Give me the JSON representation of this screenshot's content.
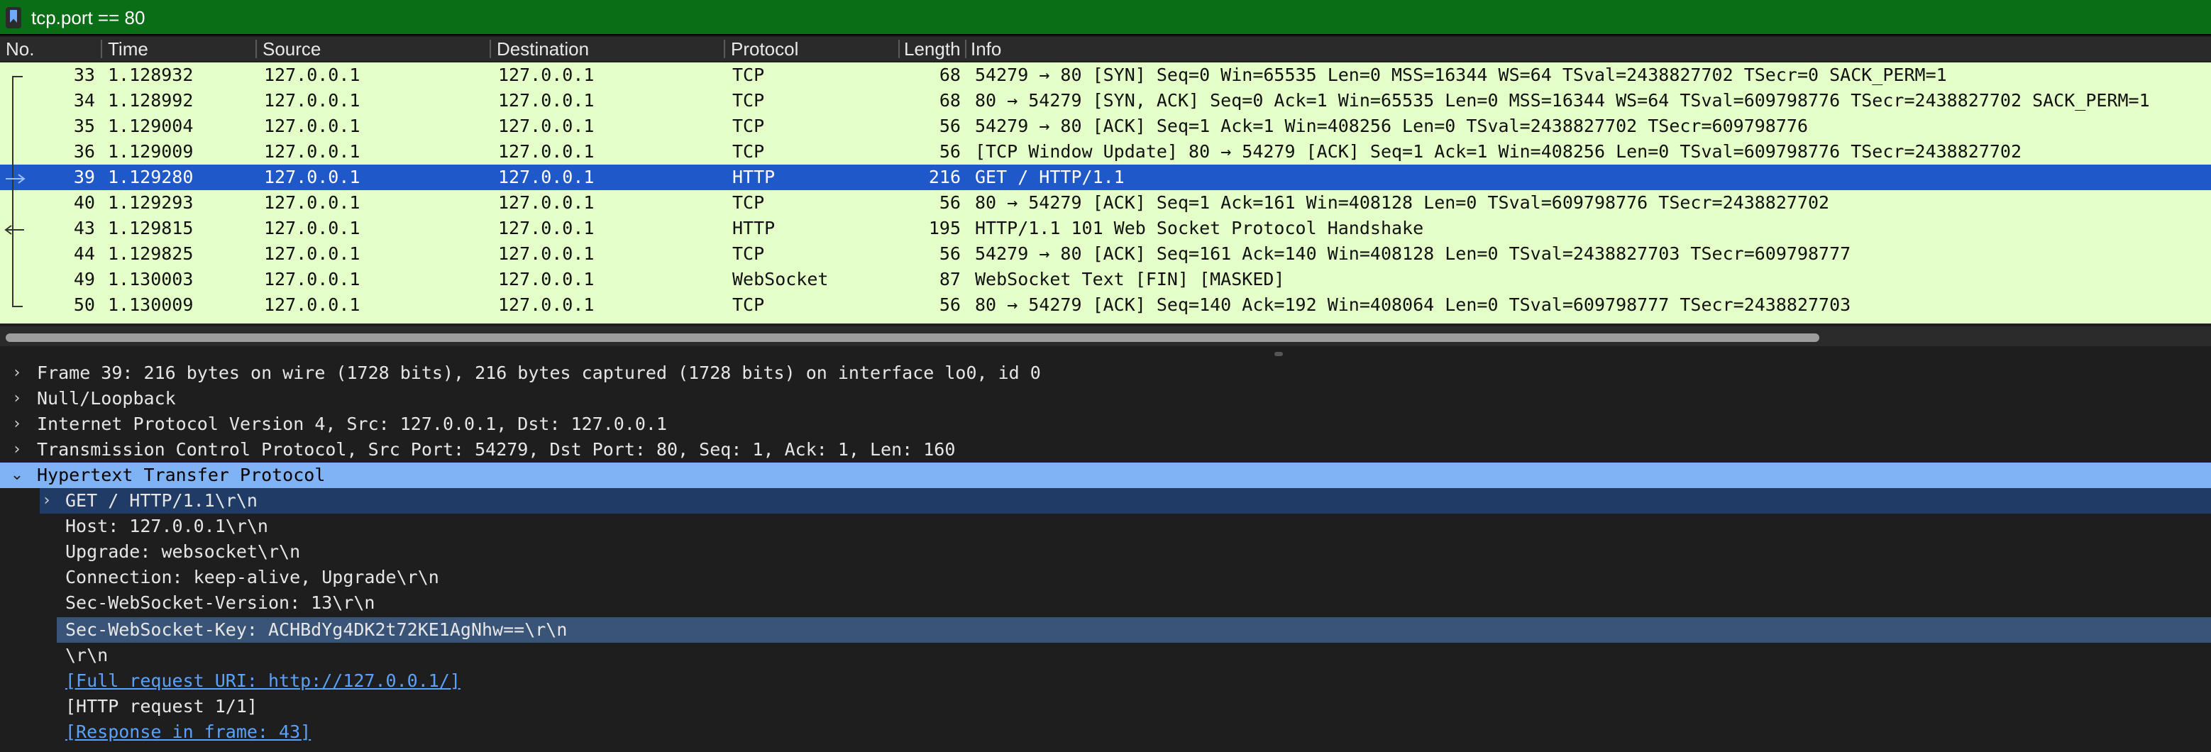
{
  "filter": {
    "value": "tcp.port == 80"
  },
  "columns": {
    "no": "No.",
    "time": "Time",
    "source": "Source",
    "destination": "Destination",
    "protocol": "Protocol",
    "length": "Length",
    "info": "Info"
  },
  "packets": [
    {
      "no": "33",
      "time": "1.128932",
      "source": "127.0.0.1",
      "destination": "127.0.0.1",
      "protocol": "TCP",
      "length": "68",
      "info": "54279 → 80 [SYN] Seq=0 Win=65535 Len=0 MSS=16344 WS=64 TSval=2438827702 TSecr=0 SACK_PERM=1"
    },
    {
      "no": "34",
      "time": "1.128992",
      "source": "127.0.0.1",
      "destination": "127.0.0.1",
      "protocol": "TCP",
      "length": "68",
      "info": "80 → 54279 [SYN, ACK] Seq=0 Ack=1 Win=65535 Len=0 MSS=16344 WS=64 TSval=609798776 TSecr=2438827702 SACK_PERM=1"
    },
    {
      "no": "35",
      "time": "1.129004",
      "source": "127.0.0.1",
      "destination": "127.0.0.1",
      "protocol": "TCP",
      "length": "56",
      "info": "54279 → 80 [ACK] Seq=1 Ack=1 Win=408256 Len=0 TSval=2438827702 TSecr=609798776"
    },
    {
      "no": "36",
      "time": "1.129009",
      "source": "127.0.0.1",
      "destination": "127.0.0.1",
      "protocol": "TCP",
      "length": "56",
      "info": "[TCP Window Update] 80 → 54279 [ACK] Seq=1 Ack=1 Win=408256 Len=0 TSval=609798776 TSecr=2438827702"
    },
    {
      "no": "39",
      "time": "1.129280",
      "source": "127.0.0.1",
      "destination": "127.0.0.1",
      "protocol": "HTTP",
      "length": "216",
      "info": "GET / HTTP/1.1"
    },
    {
      "no": "40",
      "time": "1.129293",
      "source": "127.0.0.1",
      "destination": "127.0.0.1",
      "protocol": "TCP",
      "length": "56",
      "info": "80 → 54279 [ACK] Seq=1 Ack=161 Win=408128 Len=0 TSval=609798776 TSecr=2438827702"
    },
    {
      "no": "43",
      "time": "1.129815",
      "source": "127.0.0.1",
      "destination": "127.0.0.1",
      "protocol": "HTTP",
      "length": "195",
      "info": "HTTP/1.1 101 Web Socket Protocol Handshake"
    },
    {
      "no": "44",
      "time": "1.129825",
      "source": "127.0.0.1",
      "destination": "127.0.0.1",
      "protocol": "TCP",
      "length": "56",
      "info": "54279 → 80 [ACK] Seq=161 Ack=140 Win=408128 Len=0 TSval=2438827703 TSecr=609798777"
    },
    {
      "no": "49",
      "time": "1.130003",
      "source": "127.0.0.1",
      "destination": "127.0.0.1",
      "protocol": "WebSocket",
      "length": "87",
      "info": "WebSocket Text [FIN] [MASKED]"
    },
    {
      "no": "50",
      "time": "1.130009",
      "source": "127.0.0.1",
      "destination": "127.0.0.1",
      "protocol": "TCP",
      "length": "56",
      "info": "80 → 54279 [ACK] Seq=140 Ack=192 Win=408064 Len=0 TSval=609798777 TSecr=2438827703"
    }
  ],
  "details": {
    "frame": "Frame 39: 216 bytes on wire (1728 bits), 216 bytes captured (1728 bits) on interface lo0, id 0",
    "loopback": "Null/Loopback",
    "ip": "Internet Protocol Version 4, Src: 127.0.0.1, Dst: 127.0.0.1",
    "tcp": "Transmission Control Protocol, Src Port: 54279, Dst Port: 80, Seq: 1, Ack: 1, Len: 160",
    "http": "Hypertext Transfer Protocol",
    "request_line": "GET / HTTP/1.1\\r\\n",
    "host": "Host: 127.0.0.1\\r\\n",
    "upgrade": "Upgrade: websocket\\r\\n",
    "connection": "Connection: keep-alive, Upgrade\\r\\n",
    "ws_version": "Sec-WebSocket-Version: 13\\r\\n",
    "ws_key": "Sec-WebSocket-Key: ACHBdYg4DK2t72KE1AgNhw==\\r\\n",
    "crlf": "\\r\\n",
    "full_uri": "[Full request URI: http://127.0.0.1/]",
    "request_count": "[HTTP request 1/1]",
    "response_in": "[Response in frame: 43]"
  },
  "icons": {
    "filter_bookmark": "bookmark-icon",
    "expand": "chevron-right-icon",
    "collapse": "chevron-down-icon"
  },
  "colors": {
    "filter_bg": "#0a6e16",
    "row_tcp_bg": "#e4ffc7",
    "selected_row": "#1f58c8",
    "selected_tree": "#7fb3f5",
    "link": "#5aa2ff"
  }
}
